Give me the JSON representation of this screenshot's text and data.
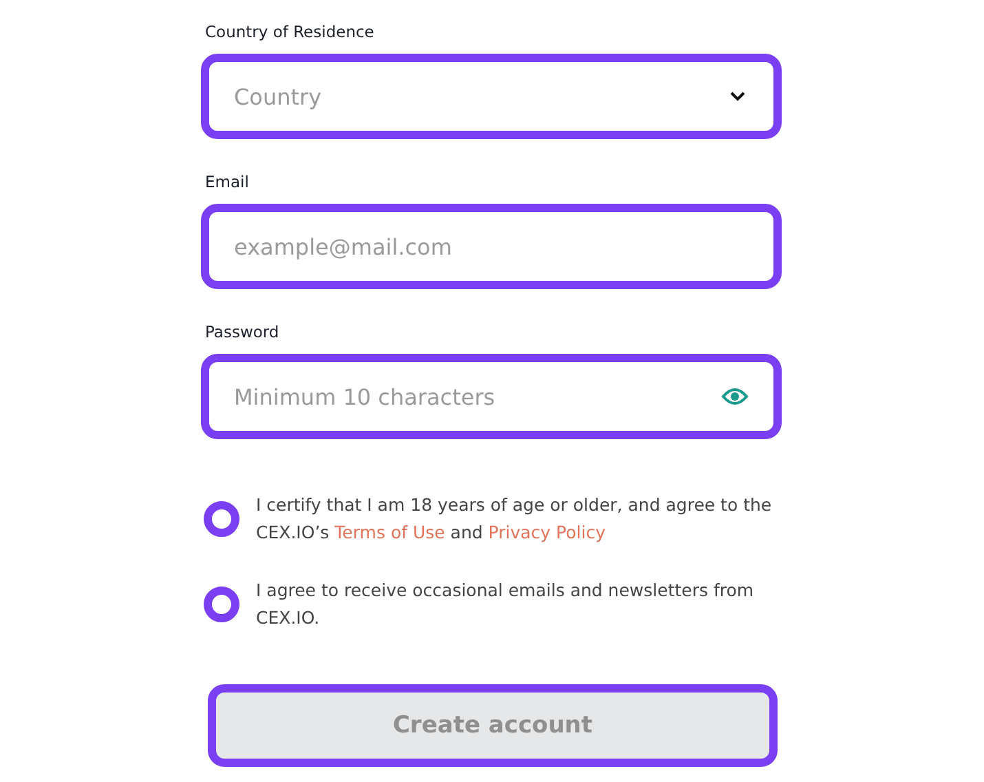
{
  "fields": [
    {
      "kind": "select",
      "label": "Country of Residence",
      "placeholder": "Country"
    },
    {
      "kind": "text",
      "label": "Email",
      "placeholder": "example@mail.com"
    },
    {
      "kind": "password",
      "label": "Password",
      "placeholder": "Minimum 10 characters"
    }
  ],
  "consents": [
    {
      "checked": false,
      "parts": [
        {
          "kind": "text",
          "text": "I certify that I am 18 years of age or older, and agree to the CEX.IO’s "
        },
        {
          "kind": "link",
          "text": "Terms of Use"
        },
        {
          "kind": "text",
          "text": " and "
        },
        {
          "kind": "link",
          "text": "Privacy Policy"
        }
      ]
    },
    {
      "checked": false,
      "parts": [
        {
          "kind": "text",
          "text": "I agree to receive occasional emails and newsletters from CEX.IO."
        }
      ]
    }
  ],
  "submit": {
    "label": "Create account",
    "disabled": true
  }
}
